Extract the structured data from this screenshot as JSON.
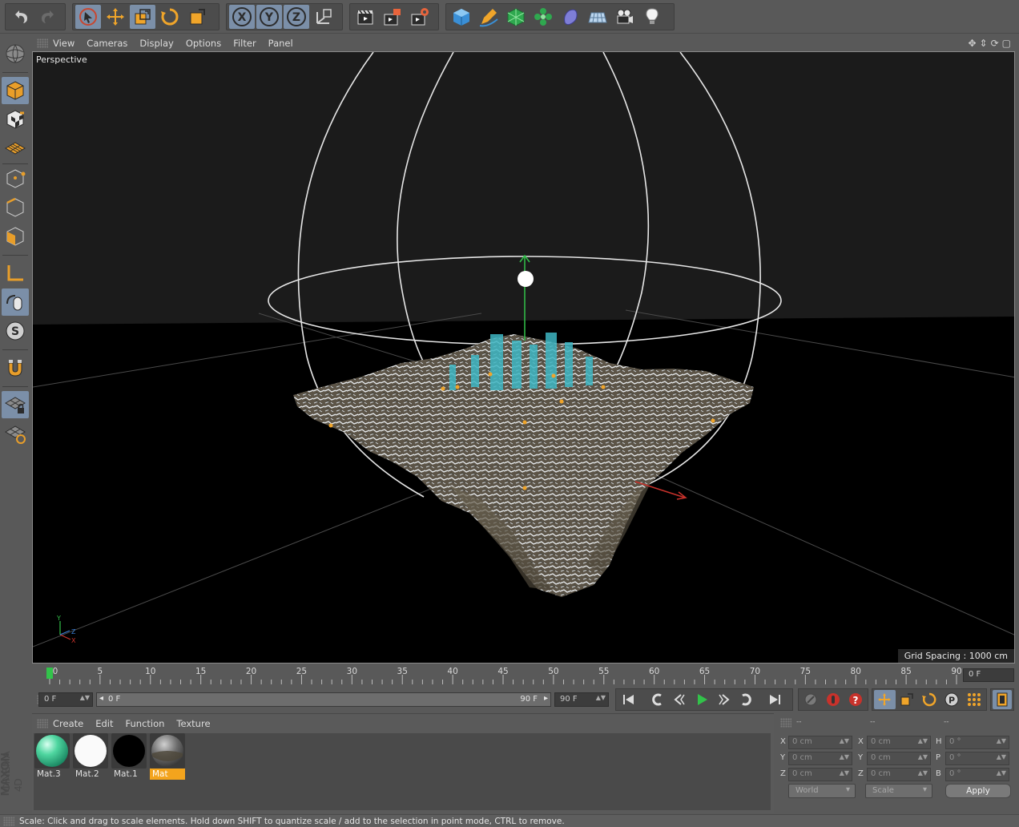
{
  "viewport": {
    "menu": [
      "View",
      "Cameras",
      "Display",
      "Options",
      "Filter",
      "Panel"
    ],
    "label": "Perspective",
    "grid_spacing": "Grid Spacing : 1000 cm",
    "axis_labels": {
      "y": "Y",
      "z": "Z",
      "x": "X"
    }
  },
  "top_toolbar": {
    "axis_buttons": [
      "X",
      "Y",
      "Z"
    ]
  },
  "timeline": {
    "ticks": [
      "0",
      "5",
      "10",
      "15",
      "20",
      "25",
      "30",
      "35",
      "40",
      "45",
      "50",
      "55",
      "60",
      "65",
      "70",
      "75",
      "80",
      "85",
      "90"
    ],
    "current_frame": "0 F"
  },
  "transport": {
    "start_field": "0 F",
    "range_start": "0 F",
    "range_end": "90 F",
    "end_field": "90 F"
  },
  "materials": {
    "menu": [
      "Create",
      "Edit",
      "Function",
      "Texture"
    ],
    "items": [
      {
        "name": "Mat.3",
        "selected": false
      },
      {
        "name": "Mat.2",
        "selected": false
      },
      {
        "name": "Mat.1",
        "selected": false
      },
      {
        "name": "Mat",
        "selected": true
      }
    ]
  },
  "coordinates": {
    "headers": [
      "--",
      "--",
      "--"
    ],
    "rows": [
      {
        "pos_label": "X",
        "pos": "0 cm",
        "size_label": "X",
        "size": "0 cm",
        "rot_label": "H",
        "rot": "0 °"
      },
      {
        "pos_label": "Y",
        "pos": "0 cm",
        "size_label": "Y",
        "size": "0 cm",
        "rot_label": "P",
        "rot": "0 °"
      },
      {
        "pos_label": "Z",
        "pos": "0 cm",
        "size_label": "Z",
        "size": "0 cm",
        "rot_label": "B",
        "rot": "0 °"
      }
    ],
    "mode_dropdown": "World",
    "type_dropdown": "Scale",
    "apply": "Apply"
  },
  "logo": {
    "line1": "MAXON",
    "line2": "CINEMA 4D"
  },
  "status": "Scale: Click and drag to scale elements. Hold down SHIFT to quantize scale / add to the selection in point mode, CTRL to remove.",
  "colors": {
    "accent": "#f3a41d",
    "active_tool": "#7b8fa8",
    "viewport_bg": "#000000"
  }
}
